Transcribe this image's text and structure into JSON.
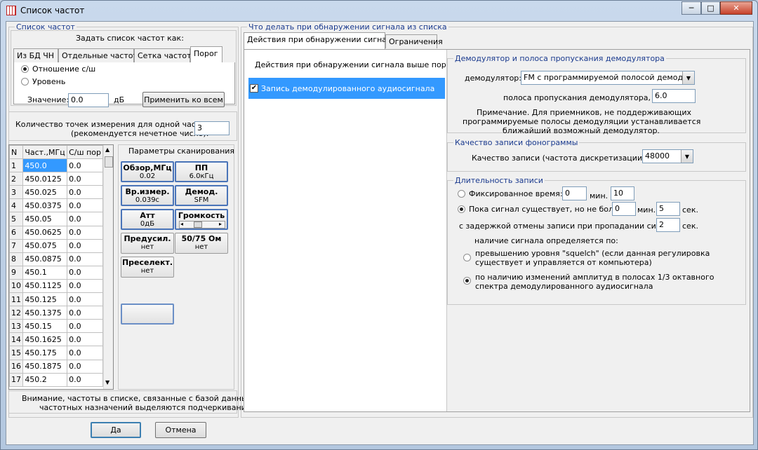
{
  "window": {
    "title": "Список частот",
    "min_label": "─",
    "max_label": "□",
    "close_label": "✕"
  },
  "left": {
    "group_title": "Список частот",
    "set_as": "Задать список частот как:",
    "tabs": [
      "Из БД ЧН",
      "Отдельные частоты",
      "Сетка частот",
      "Порог"
    ],
    "radio_ratio": "Отношение с/ш",
    "radio_level": "Уровень",
    "value_label": "Значение:",
    "value": "0.0",
    "unit_db": "дБ",
    "apply_all": "Применить ко всем",
    "points_label1": "Количество точек измерения для одной частоты",
    "points_label2": "(рекомендуется нечетное число):",
    "points_value": "3",
    "table_headers": [
      "N",
      "Част.,МГц",
      "С/ш пор"
    ],
    "rows": [
      [
        "1",
        "450.0",
        "0.0"
      ],
      [
        "2",
        "450.0125",
        "0.0"
      ],
      [
        "3",
        "450.025",
        "0.0"
      ],
      [
        "4",
        "450.0375",
        "0.0"
      ],
      [
        "5",
        "450.05",
        "0.0"
      ],
      [
        "6",
        "450.0625",
        "0.0"
      ],
      [
        "7",
        "450.075",
        "0.0"
      ],
      [
        "8",
        "450.0875",
        "0.0"
      ],
      [
        "9",
        "450.1",
        "0.0"
      ],
      [
        "10",
        "450.1125",
        "0.0"
      ],
      [
        "11",
        "450.125",
        "0.0"
      ],
      [
        "12",
        "450.1375",
        "0.0"
      ],
      [
        "13",
        "450.15",
        "0.0"
      ],
      [
        "14",
        "450.1625",
        "0.0"
      ],
      [
        "15",
        "450.175",
        "0.0"
      ],
      [
        "16",
        "450.1875",
        "0.0"
      ],
      [
        "17",
        "450.2",
        "0.0"
      ]
    ],
    "scan_title": "Параметры сканирования",
    "scan_buttons": [
      {
        "title": "Обзор,МГц",
        "value": "0.02"
      },
      {
        "title": "ПП",
        "value": "6.0кГц"
      },
      {
        "title": "Вр.измер.",
        "value": "0.039с"
      },
      {
        "title": "Демод.",
        "value": "SFM"
      },
      {
        "title": "Атт",
        "value": "0дБ"
      },
      {
        "title": "Громкость",
        "value": ""
      },
      {
        "title": "Предусил.",
        "value": "нет"
      },
      {
        "title": "50/75 Ом",
        "value": "нет"
      },
      {
        "title": "Преселект.",
        "value": "нет"
      }
    ],
    "note1": "Внимание, частоты в списке, связанные с базой данных",
    "note2": "частотных назначений выделяются подчеркиванием."
  },
  "right": {
    "group_title": "Что делать при обнаружении сигнала из списка",
    "tabs": [
      "Действия при обнаружении сигналов",
      "Ограничения"
    ],
    "actions_title": "Действия при обнаружении сигнала выше порога:",
    "action_item": "Запись демодулированного аудиосигнала",
    "demod_group": "Демодулятор и полоса пропускания демодулятора",
    "demod_label": "демодулятор:",
    "demod_value": "FM с программируемой полосой демодуляц",
    "bandwidth_label": "полоса пропускания демодулятора, кГц:",
    "bandwidth_value": "6.0",
    "note1": "Примечание. Для приемников, не поддерживающих",
    "note2": "программируемые полосы демодуляции устанавливается",
    "note3": "ближайший возможный демодулятор.",
    "quality_group": "Качество записи фонограммы",
    "quality_label": "Качество записи (частота дискретизации), Гц :",
    "quality_value": "48000",
    "duration_group": "Длительность записи",
    "fixed_label": "Фиксированное время:",
    "fixed_min": "0",
    "min_unit": "мин.",
    "fixed_sec": "10",
    "while_label": "Пока сигнал существует, но не более",
    "while_min": "0",
    "while_sec": "5",
    "sec_unit": "сек.",
    "delay_label": "с задержкой отмены записи при пропадании сигнала",
    "delay_value": "2",
    "presence_label": "наличие сигнала определяется по:",
    "squelch1": "превышению уровня \"squelch\" (если данная регулировка",
    "squelch2": "существует и управляется от компьютера)",
    "ampl1": "по наличию изменений амплитуд в полосах 1/3 октавного",
    "ampl2": "спектра демодулированного аудиосигнала"
  },
  "footer": {
    "ok": "Да",
    "cancel": "Отмена"
  }
}
